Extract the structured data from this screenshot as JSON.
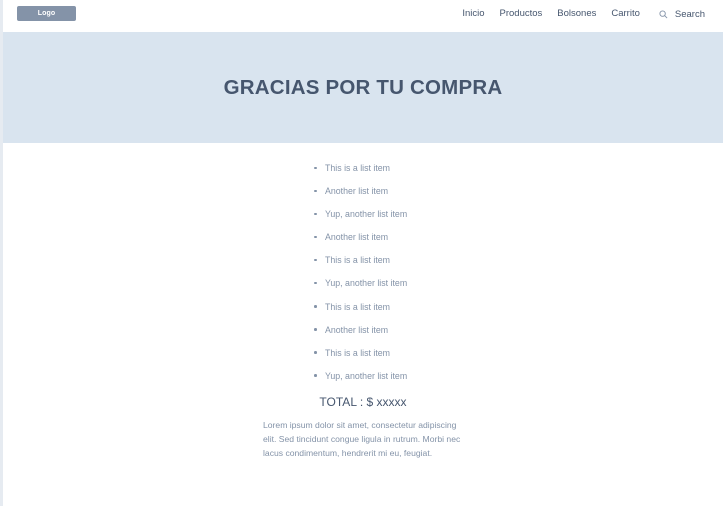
{
  "header": {
    "logo": "Logo",
    "nav": [
      "Inicio",
      "Productos",
      "Bolsones",
      "Carrito"
    ],
    "search_label": "Search"
  },
  "hero": {
    "title": "GRACIAS POR TU COMPRA"
  },
  "order": {
    "items": [
      "This is a list item",
      "Another list item",
      "Yup, another list item",
      "Another list item",
      "This is a list item",
      "Yup, another list item",
      "This is a list item",
      "Another list item",
      "This is a list item",
      "Yup, another list item"
    ],
    "total": "TOTAL : $ xxxxx",
    "description": "Lorem ipsum dolor sit amet, consectetur adipiscing elit. Sed tincidunt congue ligula in rutrum. Morbi nec lacus condimentum, hendrerit mi eu, feugiat."
  },
  "icons": {
    "search": "search-icon"
  },
  "colors": {
    "hero_bg": "#d9e4ef",
    "heading": "#46566e",
    "muted_text": "#8493a8",
    "logo_bg": "#8493a8"
  }
}
